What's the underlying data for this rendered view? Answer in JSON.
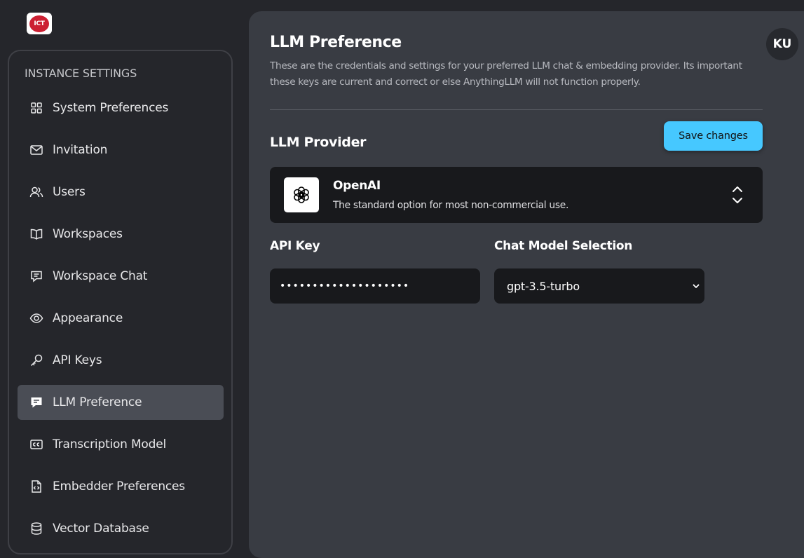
{
  "brand": {
    "logo_text": "ICT",
    "logo_color": "#cc2033"
  },
  "sidebar": {
    "heading": "INSTANCE SETTINGS",
    "items": [
      {
        "label": "System Preferences",
        "icon": "grid-icon"
      },
      {
        "label": "Invitation",
        "icon": "envelope-icon"
      },
      {
        "label": "Users",
        "icon": "users-icon"
      },
      {
        "label": "Workspaces",
        "icon": "book-icon"
      },
      {
        "label": "Workspace Chat",
        "icon": "chat-icon"
      },
      {
        "label": "Appearance",
        "icon": "eye-icon"
      },
      {
        "label": "API Keys",
        "icon": "key-icon"
      },
      {
        "label": "LLM Preference",
        "icon": "chat-filled-icon",
        "active": true
      },
      {
        "label": "Transcription Model",
        "icon": "cc-icon"
      },
      {
        "label": "Embedder Preferences",
        "icon": "code-file-icon"
      },
      {
        "label": "Vector Database",
        "icon": "database-icon"
      }
    ]
  },
  "header": {
    "avatar_initials": "KU"
  },
  "main": {
    "title": "LLM Preference",
    "description": "These are the credentials and settings for your preferred LLM chat & embedding provider. Its important these keys are current and correct or else AnythingLLM will not function properly.",
    "section_title": "LLM Provider",
    "save_label": "Save changes",
    "provider": {
      "name": "OpenAI",
      "description": "The standard option for most non-commercial use.",
      "icon": "openai-icon"
    },
    "api_key": {
      "label": "API Key",
      "value": "••••••••••••••••••••"
    },
    "model": {
      "label": "Chat Model Selection",
      "value": "gpt-3.5-turbo"
    }
  },
  "colors": {
    "accent": "#46c8ff",
    "panel": "#393c43",
    "background": "#25262b",
    "active_item": "#4a4d55"
  }
}
